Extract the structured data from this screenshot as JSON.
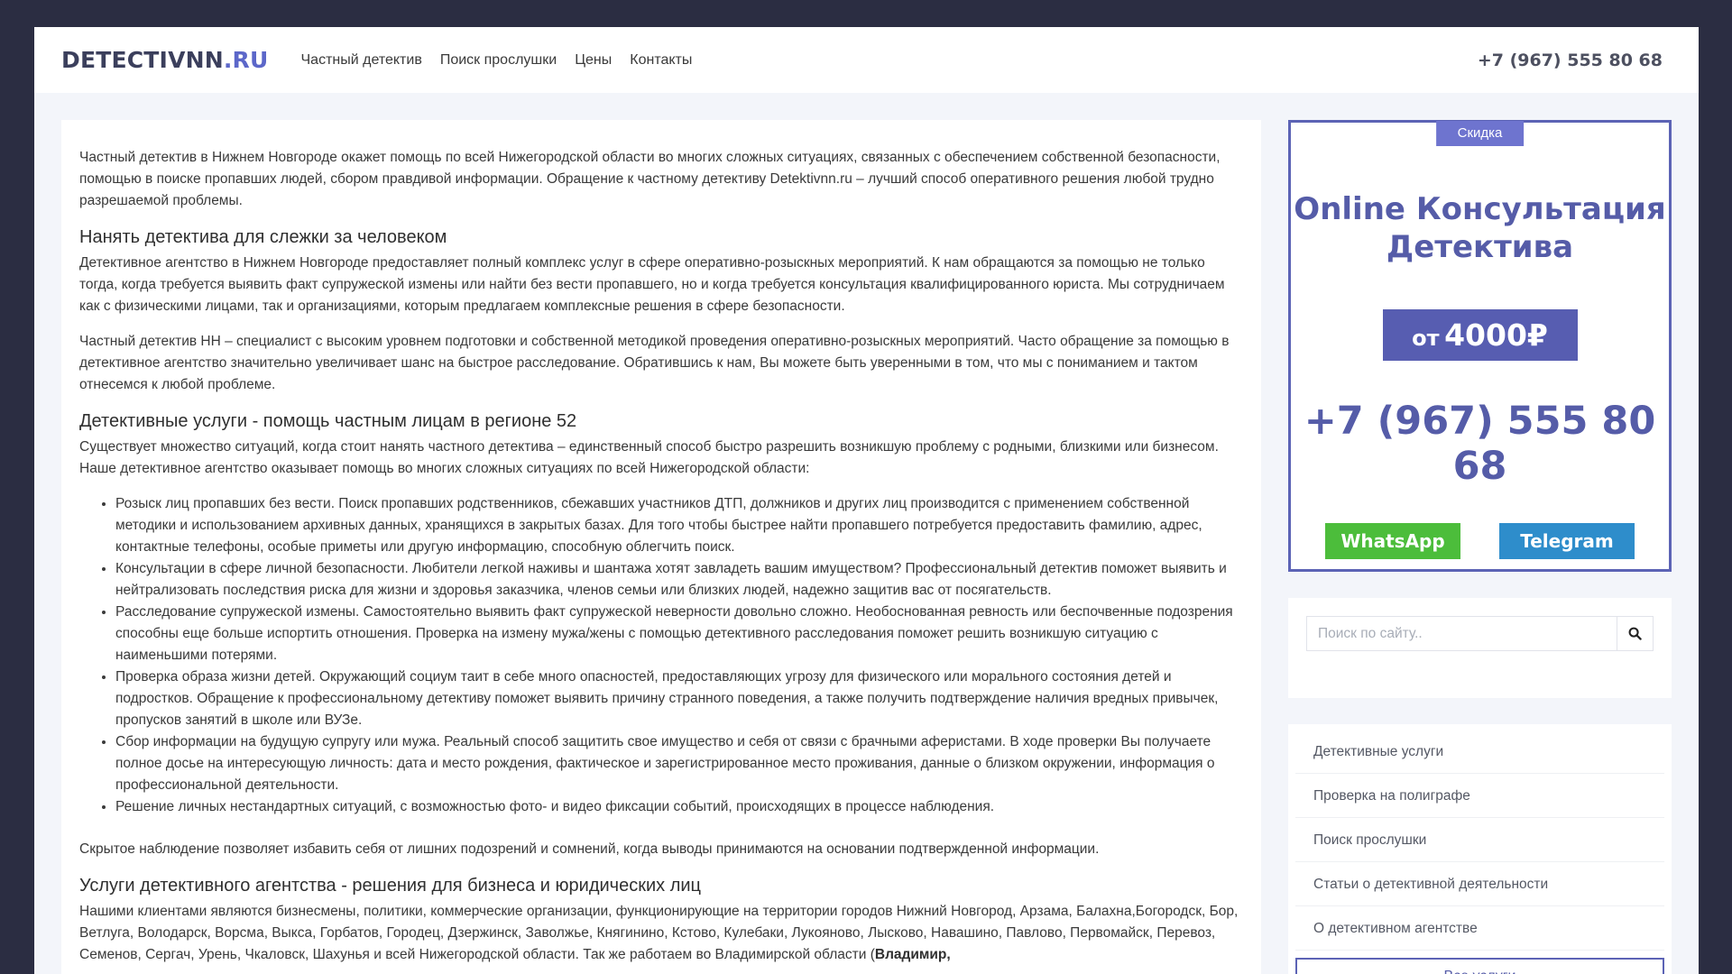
{
  "header": {
    "logo_main": "DETECTIVNN",
    "logo_ext": ".RU",
    "nav": [
      "Частный детектив",
      "Поиск прослушки",
      "Цены",
      "Контакты"
    ],
    "phone": "+7 (967) 555 80 68"
  },
  "article": {
    "intro": "Частный детектив в Нижнем Новгороде окажет помощь по всей Нижегородской области во многих сложных ситуациях, связанных с обеспечением собственной безопасности, помощью в поиске пропавших людей, сбором правдивой информации. Обращение к частному детективу Detektivnn.ru – лучший способ оперативного решения любой трудно разрешаемой проблемы.",
    "h1": "Нанять детектива для слежки за человеком",
    "p1": "Детективное агентство в Нижнем Новгороде предоставляет полный комплекс услуг в сфере оперативно-розыскных мероприятий. К нам обращаются за помощью не только тогда, когда требуется выявить факт супружеской измены или найти без вести пропавшего, но и когда требуется консультация квалифицированного юриста. Мы сотрудничаем как с физическими лицами, так и организациями, которым предлагаем комплексные решения в сфере безопасности.",
    "p2": "Частный детектив НН – специалист с высоким уровнем подготовки и собственной методикой проведения оперативно-розыскных мероприятий. Часто обращение за помощью в детективное агентство значительно увеличивает шанс на быстрое расследование. Обратившись к нам, Вы можете быть уверенными в том, что мы с пониманием и тактом отнесемся к любой проблеме.",
    "h2": "Детективные услуги - помощь частным лицам в регионе 52",
    "p3": "Существует множество ситуаций, когда стоит нанять частного детектива – единственный способ быстро разрешить возникшую проблему с родными, близкими или бизнесом. Наше детективное агентство оказывает помощь во многих сложных ситуациях по всей Нижегородской области:",
    "list": [
      "Розыск лиц пропавших без вести. Поиск пропавших родственников, сбежавших участников ДТП, должников и других лиц производится с применением собственной методики и использованием архивных данных, хранящихся в закрытых базах. Для того чтобы быстрее найти пропавшего потребуется предоставить фамилию, адрес, контактные телефоны, особые приметы или другую информацию, способную облегчить поиск.",
      "Консультации в сфере личной безопасности. Любители легкой наживы и шантажа хотят завладеть вашим имуществом? Профессиональный детектив поможет выявить и нейтрализовать последствия риска для жизни и здоровья заказчика, членов семьи или близких людей, надежно защитив вас от посягательств.",
      "Расследование супружеской измены. Самостоятельно выявить факт супружеской неверности довольно сложно. Необоснованная ревность или беспочвенные подозрения способны еще больше испортить отношения. Проверка на измену мужа/жены с помощью детективного расследования поможет решить возникшую ситуацию с наименьшими потерями.",
      "Проверка образа жизни детей. Окружающий социум таит в себе много опасностей, предоставляющих угрозу для физического или морального состояния детей и подростков. Обращение к профессиональному детективу поможет выявить причину странного поведения, а также получить подтверждение наличия вредных привычек, пропусков занятий в школе или ВУЗе.",
      "Сбор информации на будущую супругу или мужа. Реальный способ защитить свое имущество и себя от связи с брачными аферистами. В ходе проверки Вы получаете полное досье на интересующую личность: дата и место рождения, фактическое и зарегистрированное место проживания, данные о близком окружении, информация о профессиональной деятельности.",
      "Решение личных нестандартных ситуаций, с возможностью фото- и видео фиксации событий, происходящих в процессе наблюдения."
    ],
    "p4": "Скрытое наблюдение позволяет избавить себя от лишних подозрений и сомнений, когда выводы принимаются на основании подтвержденной информации.",
    "h3": "Услуги детективного агентства - решения для бизнеса и юридических лиц",
    "p5": "Нашими клиентами являются бизнесмены, политики, коммерческие организации, функционирующие на территории городов Нижний Новгород, Арзама, Балахна,Богородск, Бор, Ветлуга, Володарск, Ворсма, Выкса, Горбатов, Городец, Дзержинск, Заволжье, Княгинино, Кстово, Кулебаки, Лукояново, Лысково, Навашино, Павлово, Первомайск, Перевоз, Семенов, Сергач, Урень, Чкаловск, Шахунья и всей Нижегородской области. Так же работаем во Владимирской области (",
    "p5_bold": "Владимир,"
  },
  "promo": {
    "tag": "Скидка",
    "title_line1": "Online Консультация",
    "title_line2": "Детектива",
    "price_prefix": "от",
    "price_amount": "4000₽",
    "phone": "+7 (967) 555 80 68",
    "whatsapp": "WhatsApp",
    "telegram": "Telegram",
    "colors": {
      "accent": "#575db1",
      "whatsapp": "#4cbd3b",
      "telegram": "#2e8dcb"
    }
  },
  "search": {
    "placeholder": "Поиск по сайту..",
    "icon": "search-icon"
  },
  "services": {
    "items": [
      "Детективные услуги",
      "Проверка на полиграфе",
      "Поиск прослушки",
      "Статьи о детективной деятельности",
      "О детективном агентстве"
    ],
    "all_label": "Все услуги"
  }
}
